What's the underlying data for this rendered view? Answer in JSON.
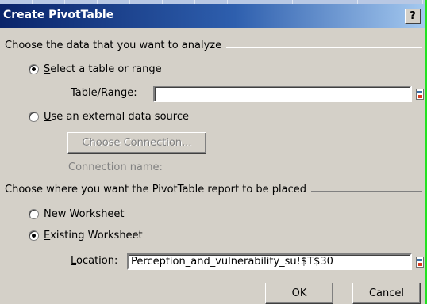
{
  "dialog": {
    "title": "Create PivotTable",
    "help_label": "?"
  },
  "data_section": {
    "heading": "Choose the data that you want to analyze",
    "option_table": {
      "key": "S",
      "rest": "elect a table or range",
      "selected": true
    },
    "table_range": {
      "key": "T",
      "rest": "able/Range:",
      "value": ""
    },
    "option_external": {
      "key": "U",
      "rest": "se an external data source",
      "selected": false
    },
    "choose_connection_label": "Choose Connection...",
    "connection_name_label": "Connection name:"
  },
  "placement_section": {
    "heading": "Choose where you want the PivotTable report to be placed",
    "option_new": {
      "key": "N",
      "rest": "ew Worksheet",
      "selected": false
    },
    "option_existing": {
      "key": "E",
      "rest": "xisting Worksheet",
      "selected": true
    },
    "location": {
      "key": "L",
      "rest": "ocation:",
      "value": "Perception_and_vulnerability_su!$T$30"
    }
  },
  "buttons": {
    "ok": "OK",
    "cancel": "Cancel"
  }
}
